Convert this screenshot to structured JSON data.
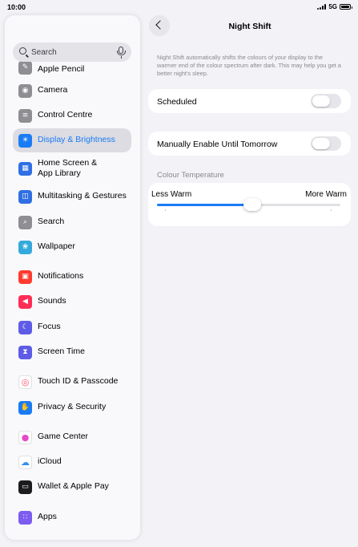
{
  "status_bar": {
    "time": "10:00",
    "network": "5G"
  },
  "sidebar": {
    "search": {
      "placeholder": "Search"
    },
    "items": [
      {
        "label": "Apple Pencil",
        "icon": "pencil-icon",
        "color": "#8e8e93",
        "glyph": "✎"
      },
      {
        "label": "Camera",
        "icon": "camera-icon",
        "color": "#8e8e93",
        "glyph": "◉"
      },
      {
        "label": "Control Centre",
        "icon": "switches-icon",
        "color": "#8e8e93",
        "glyph": "≡"
      },
      {
        "label": "Display & Brightness",
        "icon": "sun-icon",
        "color": "#1a7cf5",
        "glyph": "☀",
        "selected": true
      },
      {
        "label": "Home Screen &\nApp Library",
        "icon": "home-screen-icon",
        "color": "#2f6fe4",
        "glyph": "▦"
      },
      {
        "label": "Multitasking & Gestures",
        "icon": "multitasking-icon",
        "color": "#2f6fe4",
        "glyph": "◫"
      },
      {
        "label": "Search",
        "icon": "search-icon",
        "color": "#8e8e93",
        "glyph": "⌕"
      },
      {
        "label": "Wallpaper",
        "icon": "flower-icon",
        "color": "#34aadc",
        "glyph": "❀"
      },
      {
        "label": "Notifications",
        "icon": "bell-icon",
        "color": "#ff3b30",
        "glyph": "▣"
      },
      {
        "label": "Sounds",
        "icon": "speaker-icon",
        "color": "#ff2d55",
        "glyph": "◀"
      },
      {
        "label": "Focus",
        "icon": "moon-icon",
        "color": "#5e5ce6",
        "glyph": "☾"
      },
      {
        "label": "Screen Time",
        "icon": "hourglass-icon",
        "color": "#5e5ce6",
        "glyph": "⧗"
      },
      {
        "label": "Touch ID & Passcode",
        "icon": "fingerprint-icon",
        "color": "#ffffff",
        "glyph": "◎"
      },
      {
        "label": "Privacy & Security",
        "icon": "hand-icon",
        "color": "#1a7cf5",
        "glyph": "✋"
      },
      {
        "label": "Game Center",
        "icon": "game-center-icon",
        "color": "#ffffff",
        "glyph": "●"
      },
      {
        "label": "iCloud",
        "icon": "cloud-icon",
        "color": "#ffffff",
        "glyph": "☁"
      },
      {
        "label": "Wallet & Apple Pay",
        "icon": "wallet-icon",
        "color": "#1c1c1e",
        "glyph": "▭"
      },
      {
        "label": "Apps",
        "icon": "apps-grid-icon",
        "color": "#7d5cf0",
        "glyph": "∷"
      }
    ]
  },
  "detail": {
    "title": "Night Shift",
    "description": "Night Shift automatically shifts the colours of your display to the warmer end of the colour spectrum after dark. This may help you get a better night's sleep.",
    "scheduled": {
      "label": "Scheduled",
      "on": false
    },
    "manual": {
      "label": "Manually Enable Until Tomorrow",
      "on": false
    },
    "colour_temperature": {
      "header": "Colour Temperature",
      "min_label": "Less Warm",
      "max_label": "More Warm",
      "value_fraction": 0.5
    }
  },
  "colors": {
    "accent": "#1a7cf5",
    "background": "#f2f2f7",
    "toggle_off": "#e5e5ea"
  }
}
